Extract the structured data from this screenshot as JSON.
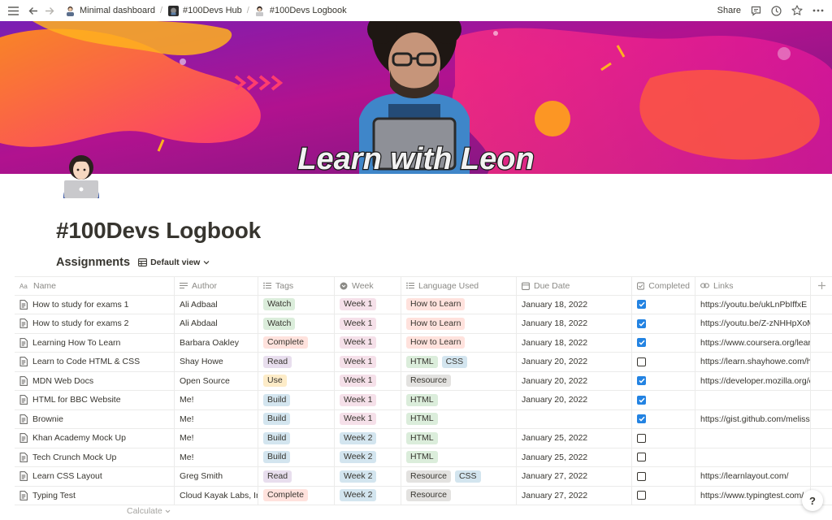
{
  "breadcrumbs": [
    {
      "label": "Minimal dashboard"
    },
    {
      "label": "#100Devs Hub"
    },
    {
      "label": "#100Devs Logbook"
    }
  ],
  "topbar": {
    "share_label": "Share"
  },
  "banner": {
    "text": "Learn with Leon"
  },
  "page": {
    "title": "#100Devs Logbook"
  },
  "database": {
    "title": "Assignments",
    "view_label": "Default view"
  },
  "columns": {
    "name": "Name",
    "author": "Author",
    "tags": "Tags",
    "week": "Week",
    "language": "Language Used",
    "due": "Due Date",
    "completed": "Completed",
    "links": "Links"
  },
  "rows": [
    {
      "name": "How to study for exams 1",
      "author": "Ali Adbaal",
      "tag": "Watch",
      "week": "Week 1",
      "langs": [
        "How to Learn"
      ],
      "due": "January 18, 2022",
      "done": true,
      "link": "https://youtu.be/ukLnPbIffxE"
    },
    {
      "name": "How to study for exams 2",
      "author": "Ali Abdaal",
      "tag": "Watch",
      "week": "Week 1",
      "langs": [
        "How to Learn"
      ],
      "due": "January 18, 2022",
      "done": true,
      "link": "https://youtu.be/Z-zNHHpXoMM"
    },
    {
      "name": "Learning How To Learn",
      "author": "Barbara Oakley",
      "tag": "Complete",
      "week": "Week 1",
      "langs": [
        "How to Learn"
      ],
      "due": "January 18, 2022",
      "done": true,
      "link": "https://www.coursera.org/learn/learning-how-to-learn"
    },
    {
      "name": "Learn to Code HTML & CSS",
      "author": "Shay Howe",
      "tag": "Read",
      "week": "Week 1",
      "langs": [
        "HTML",
        "CSS"
      ],
      "due": "January 20, 2022",
      "done": false,
      "link": "https://learn.shayhowe.com/html-css/"
    },
    {
      "name": "MDN Web Docs",
      "author": "Open Source",
      "tag": "Use",
      "week": "Week 1",
      "langs": [
        "Resource"
      ],
      "due": "January 20, 2022",
      "done": true,
      "link": "https://developer.mozilla.org/en-US/"
    },
    {
      "name": "HTML for BBC Website",
      "author": "Me!",
      "tag": "Build",
      "week": "Week 1",
      "langs": [
        "HTML"
      ],
      "due": "January 20, 2022",
      "done": true,
      "link": ""
    },
    {
      "name": "Brownie",
      "author": "Me!",
      "tag": "Build",
      "week": "Week 1",
      "langs": [
        "HTML"
      ],
      "due": "",
      "done": true,
      "link": "https://gist.github.com/melissa"
    },
    {
      "name": "Khan Academy Mock Up",
      "author": "Me!",
      "tag": "Build",
      "week": "Week 2",
      "langs": [
        "HTML"
      ],
      "due": "January 25, 2022",
      "done": false,
      "link": ""
    },
    {
      "name": "Tech Crunch Mock Up",
      "author": "Me!",
      "tag": "Build",
      "week": "Week 2",
      "langs": [
        "HTML"
      ],
      "due": "January 25, 2022",
      "done": false,
      "link": ""
    },
    {
      "name": "Learn CSS Layout",
      "author": "Greg Smith",
      "tag": "Read",
      "week": "Week 2",
      "langs": [
        "Resource",
        "CSS"
      ],
      "due": "January 27, 2022",
      "done": false,
      "link": "https://learnlayout.com/"
    },
    {
      "name": "Typing Test",
      "author": "Cloud Kayak Labs, Inc.",
      "tag": "Complete",
      "week": "Week 2",
      "langs": [
        "Resource"
      ],
      "due": "January 27, 2022",
      "done": false,
      "link": "https://www.typingtest.com/"
    }
  ],
  "footer": {
    "calculate_label": "Calculate"
  },
  "help_label": "?",
  "colors": {
    "tag_watch": "#dbeddb",
    "tag_complete": "#ffe2dd",
    "tag_read": "#e8deee",
    "tag_use": "#fdecc8",
    "tag_build": "#d3e5ef",
    "week1": "#f5e0e9",
    "week2": "#d3e5ef",
    "lang_howto": "#ffe2dd",
    "lang_html": "#dbeddb",
    "lang_css": "#d3e5ef",
    "lang_resource": "#e3e2e0",
    "checkbox_on": "#2383e2"
  }
}
